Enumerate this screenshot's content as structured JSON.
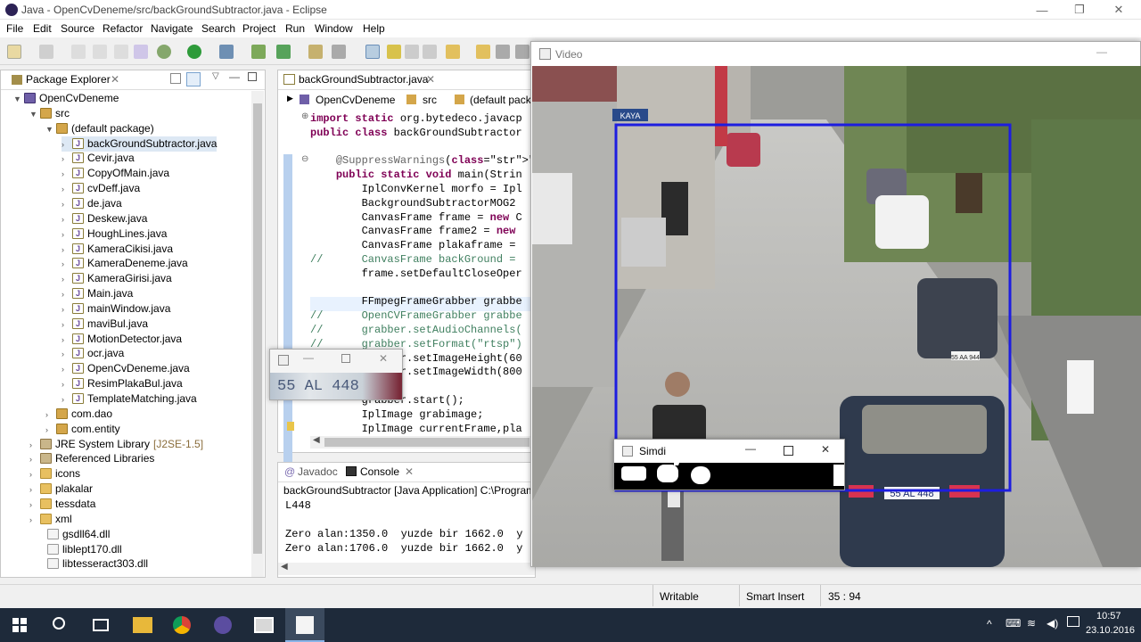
{
  "window": {
    "title": "Java - OpenCvDeneme/src/backGroundSubtractor.java - Eclipse",
    "min": "—",
    "max": "❐",
    "close": "✕"
  },
  "menu": [
    "File",
    "Edit",
    "Source",
    "Refactor",
    "Navigate",
    "Search",
    "Project",
    "Run",
    "Window",
    "Help"
  ],
  "package_explorer": {
    "title": "Package Explorer",
    "project": "OpenCvDeneme",
    "src": "src",
    "default_package": "(default package)",
    "files": [
      "backGroundSubtractor.java",
      "Cevir.java",
      "CopyOfMain.java",
      "cvDeff.java",
      "de.java",
      "Deskew.java",
      "HoughLines.java",
      "KameraCikisi.java",
      "KameraDeneme.java",
      "KameraGirisi.java",
      "Main.java",
      "mainWindow.java",
      "maviBul.java",
      "MotionDetector.java",
      "ocr.java",
      "OpenCvDeneme.java",
      "ResimPlakaBul.java",
      "TemplateMatching.java"
    ],
    "packages": [
      "com.dao",
      "com.entity"
    ],
    "jre": "JRE System Library",
    "jre_version": "[J2SE-1.5]",
    "libs": [
      "Referenced Libraries"
    ],
    "folders": [
      "icons",
      "plakalar",
      "tessdata",
      "xml"
    ],
    "dlls": [
      "gsdll64.dll",
      "liblept170.dll",
      "libtesseract303.dll"
    ]
  },
  "editor": {
    "tab": "backGroundSubtractor.java",
    "breadcrumb": [
      "OpenCvDeneme",
      "src",
      "(default packa"
    ],
    "lines": [
      "import static org.bytedeco.javacp",
      "public class backGroundSubtractor",
      "",
      "    @SuppressWarnings(\"static-acc",
      "    public static void main(Strin",
      "        IplConvKernel morfo = Ipl",
      "        BackgroundSubtractorMOG2 ",
      "        CanvasFrame frame = new C",
      "        CanvasFrame frame2 = new ",
      "        CanvasFrame plakaframe = ",
      "//      CanvasFrame backGround = ",
      "        frame.setDefaultCloseOper",
      "",
      "        FFmpegFrameGrabber grabbe",
      "//      OpenCVFrameGrabber grabbe",
      "//      grabber.setAudioChannels(",
      "//      grabber.setFormat(\"rtsp\")",
      "        grabber.setImageHeight(60",
      "        grabber.setImageWidth(800",
      "",
      "        grabber.start();",
      "        IplImage grabimage;",
      "        IplImage currentFrame,pla"
    ]
  },
  "console": {
    "tab_javadoc": "Javadoc",
    "tab_console": "Console",
    "header": "backGroundSubtractor [Java Application] C:\\Program Fil",
    "lines": [
      "L448",
      "Zero alan:1350.0  yuzde bir 1662.0  y",
      "Zero alan:1706.0  yuzde bir 1662.0  y"
    ]
  },
  "status": {
    "writable": "Writable",
    "insert": "Smart Insert",
    "pos": "35 : 94"
  },
  "video": {
    "title": "Video",
    "plate": "55 AL 448",
    "plate_small": "55 AA 944"
  },
  "popup": {
    "plate": "55 AL 448"
  },
  "simdi": {
    "title": "Simdi"
  },
  "signs": {
    "kaya": "KAYA"
  },
  "taskbar": {
    "time": "10:57",
    "date": "23.10.2016"
  }
}
